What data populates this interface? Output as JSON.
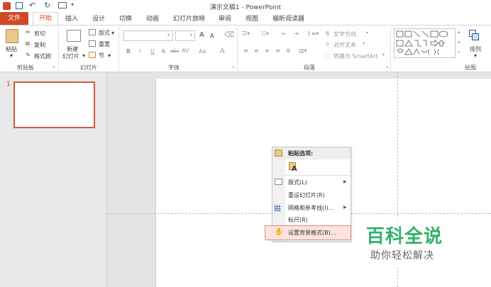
{
  "window": {
    "title": "演示文稿1 - PowerPoint"
  },
  "tabs": [
    {
      "label": "文件"
    },
    {
      "label": "开始"
    },
    {
      "label": "插入"
    },
    {
      "label": "设计"
    },
    {
      "label": "切换"
    },
    {
      "label": "动画"
    },
    {
      "label": "幻灯片放映"
    },
    {
      "label": "审阅"
    },
    {
      "label": "视图"
    },
    {
      "label": "福昕阅读器"
    }
  ],
  "ribbon": {
    "clipboard": {
      "paste": "粘贴",
      "cut": "剪切",
      "copy": "复制",
      "format_painter": "格式刷",
      "group": "剪贴板"
    },
    "slides": {
      "new_slide_1": "新建",
      "new_slide_2": "幻灯片",
      "layout": "版式",
      "reset": "重置",
      "section": "节",
      "group": "幻灯片"
    },
    "font": {
      "group": "字体",
      "bold": "B",
      "italic": "I",
      "underline": "U",
      "strike": "S",
      "spacing": "abc",
      "aa": "Aa",
      "grow": "A",
      "shrink": "A"
    },
    "paragraph": {
      "group": "段落",
      "text_direction": "文字方向",
      "align_text": "对齐文本",
      "smartart": "转换为 SmartArt"
    },
    "drawing": {
      "arrange": "排列",
      "group": "绘图"
    }
  },
  "thumbnails": [
    {
      "number": "1"
    }
  ],
  "context_menu": {
    "paste_options": "粘贴选项:",
    "layout": "版式(L)",
    "reset_slide": "重设幻灯片(R)",
    "grid_guides": "网格和参考线(I)...",
    "ruler": "标尺(R)",
    "format_background": "设置背景格式(B)..."
  },
  "watermark": {
    "title": "百科全说",
    "subtitle": "助你轻松解决"
  },
  "colors": {
    "accent": "#d24726",
    "watermark": "#2fb36a"
  }
}
